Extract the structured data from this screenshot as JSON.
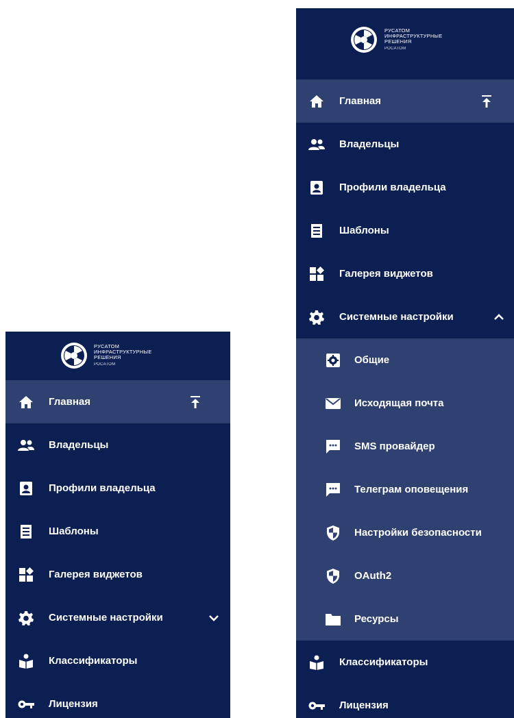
{
  "brand": {
    "line1": "РУСАТОМ",
    "line2": "ИНФРАСТРУКТУРНЫЕ",
    "line3": "РЕШЕНИЯ",
    "line4": "РОСАТОМ"
  },
  "colors": {
    "sidebar_bg": "#0b1f52",
    "active_bg": "#2f4170",
    "text": "#ffffff"
  },
  "collapsed": {
    "items": [
      {
        "label": "Главная",
        "icon": "home-icon",
        "active": true
      },
      {
        "label": "Владельцы",
        "icon": "users-icon"
      },
      {
        "label": "Профили владельца",
        "icon": "profile-icon"
      },
      {
        "label": "Шаблоны",
        "icon": "template-icon"
      },
      {
        "label": "Галерея виджетов",
        "icon": "widgets-icon"
      },
      {
        "label": "Системные настройки",
        "icon": "gear-icon",
        "expanded": false
      },
      {
        "label": "Классификаторы",
        "icon": "classifier-icon"
      },
      {
        "label": "Лицензия",
        "icon": "key-icon"
      }
    ]
  },
  "expanded": {
    "items": [
      {
        "label": "Главная",
        "icon": "home-icon",
        "active": true
      },
      {
        "label": "Владельцы",
        "icon": "users-icon"
      },
      {
        "label": "Профили владельца",
        "icon": "profile-icon"
      },
      {
        "label": "Шаблоны",
        "icon": "template-icon"
      },
      {
        "label": "Галерея виджетов",
        "icon": "widgets-icon"
      },
      {
        "label": "Системные настройки",
        "icon": "gear-icon",
        "expanded": true
      }
    ],
    "submenu": [
      {
        "label": "Общие",
        "icon": "gear-box-icon"
      },
      {
        "label": "Исходящая почта",
        "icon": "mail-icon"
      },
      {
        "label": "SMS провайдер",
        "icon": "message-icon"
      },
      {
        "label": "Телеграм оповещения",
        "icon": "message-icon"
      },
      {
        "label": "Настройки безопасности",
        "icon": "shield-icon"
      },
      {
        "label": "OAuth2",
        "icon": "shield-icon"
      },
      {
        "label": "Ресурсы",
        "icon": "folder-icon"
      }
    ],
    "after": [
      {
        "label": "Классификаторы",
        "icon": "classifier-icon"
      },
      {
        "label": "Лицензия",
        "icon": "key-icon"
      }
    ]
  }
}
